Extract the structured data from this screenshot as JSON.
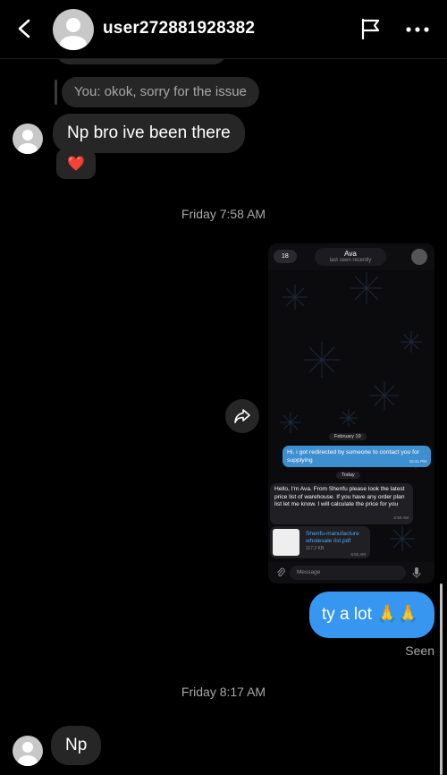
{
  "header": {
    "username": "user272881928382",
    "back_icon": "chevron-left-icon",
    "report_icon": "flag-icon",
    "more_icon": "more-horizontal-icon"
  },
  "thread": {
    "reply_preview": "You: okok, sorry for the issue",
    "msg_1": "Np bro ive been there",
    "reaction": "❤️",
    "time_1": "Friday 7:58 AM",
    "msg_out": "ty a lot 🙏🙏",
    "seen": "Seen",
    "time_2": "Friday 8:17 AM",
    "msg_2": "Np"
  },
  "shared_screenshot": {
    "back_badge": "18",
    "contact_name": "Ava",
    "contact_status": "last seen recently",
    "date_chip": "February 19",
    "outgoing_text": "Hi, i got redirected by someone to contact you for supplying",
    "outgoing_time": "15:41 PM",
    "today_chip": "Today",
    "incoming_text": "Hello, I'm Ava. From Shenfu please look the latest price list of warehouse. If you have any order plan list let me know. I will calculate the price for you",
    "incoming_time": "6:50 AM",
    "file_name": "Shenfu-manufacture wholesale list.pdf",
    "file_size": "117.2 KB",
    "file_time": "6:50 AM",
    "input_placeholder": "Message"
  },
  "colors": {
    "background": "#000000",
    "incoming_bubble": "#262626",
    "outgoing_bubble": "#3797f0",
    "secondary_text": "#a8a8a8"
  }
}
